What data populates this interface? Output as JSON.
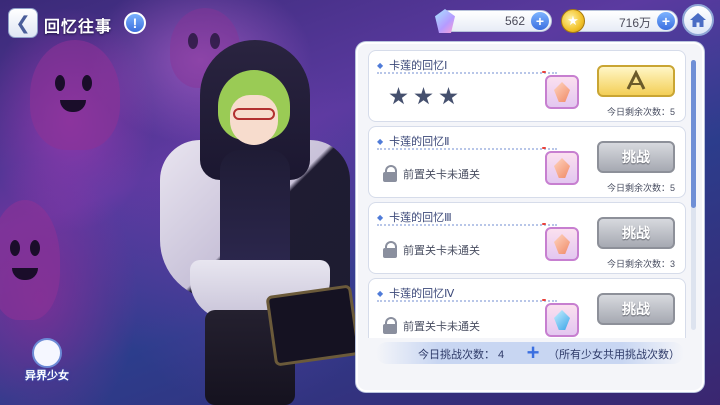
{
  "header": {
    "back_icon": "back-arrow-icon",
    "title": "回忆往事",
    "info_icon": "exclamation-icon"
  },
  "currencies": [
    {
      "icon": "gem-icon",
      "value": "562"
    },
    {
      "icon": "coin-icon",
      "value": "716万"
    }
  ],
  "home_icon": "home-icon",
  "stages": [
    {
      "title": "卡莲的回忆Ⅰ",
      "status": "cleared",
      "stars": 3,
      "action_icon": "sweep-icon",
      "remaining": "今日剩余次数：5"
    },
    {
      "title": "卡莲的回忆Ⅱ",
      "status": "locked",
      "locked_text": "前置关卡未通关",
      "action": "挑战",
      "remaining": "今日剩余次数：5"
    },
    {
      "title": "卡莲的回忆Ⅲ",
      "status": "locked",
      "locked_text": "前置关卡未通关",
      "action": "挑战",
      "remaining": "今日剩余次数：3"
    },
    {
      "title": "卡莲的回忆Ⅳ",
      "status": "locked",
      "locked_text": "前置关卡未通关",
      "action": "挑战",
      "remaining": ""
    }
  ],
  "footer": {
    "label": "今日挑战次数： 4",
    "note": "（所有少女共用挑战次数）"
  },
  "logo": {
    "text": "异界少女"
  },
  "colors": {
    "accent": "#3b6fe0",
    "panel": "#f4f5f9",
    "active_button": "#f3cf57"
  }
}
